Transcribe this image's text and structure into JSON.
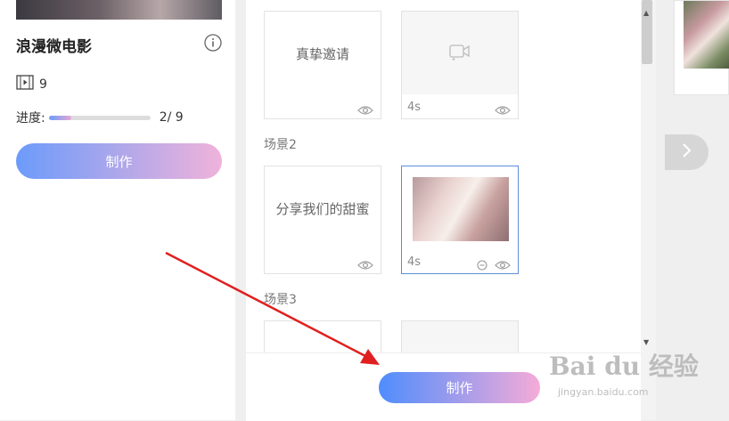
{
  "left": {
    "title": "浪漫微电影",
    "clip_count": "9",
    "progress_label": "进度:",
    "progress_value": 0.22,
    "progress_text": "2/ 9",
    "make_label": "制作"
  },
  "middle": {
    "cards_top": [
      {
        "text": "真挚邀请",
        "duration": ""
      },
      {
        "text": "",
        "duration": "4s"
      }
    ],
    "scene2_label": "场景2",
    "cards_scene2": [
      {
        "text": "分享我们的甜蜜",
        "duration": ""
      },
      {
        "text": "",
        "duration": "4s"
      }
    ],
    "scene3_label": "场景3",
    "make_label": "制作"
  },
  "watermark": {
    "main": "Bai du 经验",
    "sub": "jingyan.baidu.com"
  },
  "icons": {
    "info": "info-icon",
    "film": "film-icon",
    "eye": "eye-icon",
    "video_add": "video-add-icon",
    "minus": "minus-circle-icon",
    "next": "chevron-right-icon"
  },
  "colors": {
    "gradient_start": "#4f8dfd",
    "gradient_end": "#f5abd8",
    "selected_border": "#5b8fd8",
    "annotation_arrow": "#e02020"
  }
}
